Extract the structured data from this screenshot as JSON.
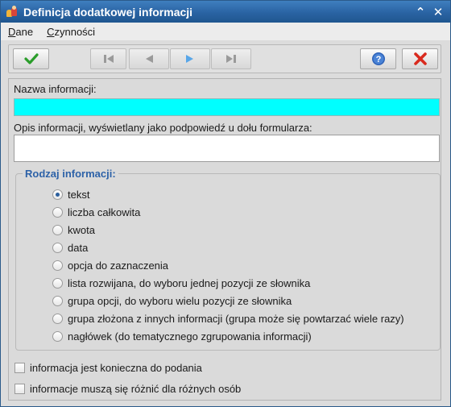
{
  "window": {
    "title": "Definicja dodatkowej informacji",
    "collapse_glyph": "⌃",
    "close_glyph": "✕"
  },
  "menu": [
    {
      "label_first": "D",
      "label_rest": "ane"
    },
    {
      "label_first": "C",
      "label_rest": "zynności"
    }
  ],
  "toolbar": {
    "icons": [
      "check-icon",
      "first-record-icon",
      "previous-record-icon",
      "next-record-icon",
      "last-record-icon",
      "help-icon",
      "close-icon"
    ],
    "colors": {
      "check": "#2a9d2a",
      "nav_disabled": "#9a9a9a",
      "nav_active": "#58a6e8",
      "help": "#2d62b8",
      "close": "#d92a1e"
    }
  },
  "form": {
    "name_label": "Nazwa informacji:",
    "name_value": "",
    "description_label": "Opis informacji, wyświetlany jako podpowiedź u dołu formularza:",
    "description_value": "",
    "type_group_title": "Rodzaj informacji:",
    "type_options": [
      {
        "label": "tekst",
        "checked": true
      },
      {
        "label": "liczba całkowita",
        "checked": false
      },
      {
        "label": "kwota",
        "checked": false
      },
      {
        "label": "data",
        "checked": false
      },
      {
        "label": "opcja do zaznaczenia",
        "checked": false
      },
      {
        "label": "lista rozwijana, do wyboru jednej pozycji ze słownika",
        "checked": false
      },
      {
        "label": "grupa opcji, do wyboru wielu pozycji ze słownika",
        "checked": false
      },
      {
        "label": "grupa złożona z innych informacji (grupa może się powtarzać wiele razy)",
        "checked": false
      },
      {
        "label": "nagłówek (do tematycznego zgrupowania informacji)",
        "checked": false
      }
    ],
    "checkboxes": [
      {
        "label": "informacja jest konieczna do podania",
        "checked": false
      },
      {
        "label": "informacje muszą się różnić dla różnych osób",
        "checked": false
      }
    ],
    "accent_color": "#00ffff"
  }
}
